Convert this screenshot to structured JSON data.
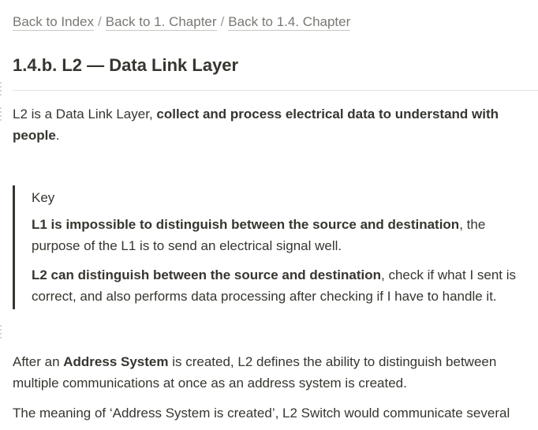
{
  "breadcrumb": {
    "items": [
      {
        "label": "Back to Index"
      },
      {
        "label": "Back to 1. Chapter"
      },
      {
        "label": "Back to 1.4. Chapter"
      }
    ],
    "separator": "/"
  },
  "page": {
    "title": "1.4.b. L2 — Data Link Layer"
  },
  "intro": {
    "plain": "L2 is a Data Link Layer, ",
    "bold": "collect and process electrical data to understand with people",
    "end": "."
  },
  "quote": {
    "heading": "Key",
    "p1": {
      "bold": "L1 is impossible to distinguish between the source and destination",
      "rest": ", the purpose of the L1 is to send an electrical signal well."
    },
    "p2": {
      "bold": "L2 can distinguish between the source and destination",
      "rest": ", check if what I sent is correct, and also performs data processing after checking if I have to handle it."
    }
  },
  "after_address": {
    "pre": "After an ",
    "bold": "Address System",
    "rest": " is created, L2 defines the ability to distinguish between multiple communications at once as an address system is created."
  },
  "meaning": {
    "text": "The meaning of ‘Address System is created’, L2 Switch would communicate several"
  },
  "icons": {
    "drag_handle": "drag-handle-icon"
  },
  "colors": {
    "text": "#37352f",
    "muted": "#7a7873",
    "quote_border": "#37352f",
    "divider": "#e5e4e1"
  }
}
